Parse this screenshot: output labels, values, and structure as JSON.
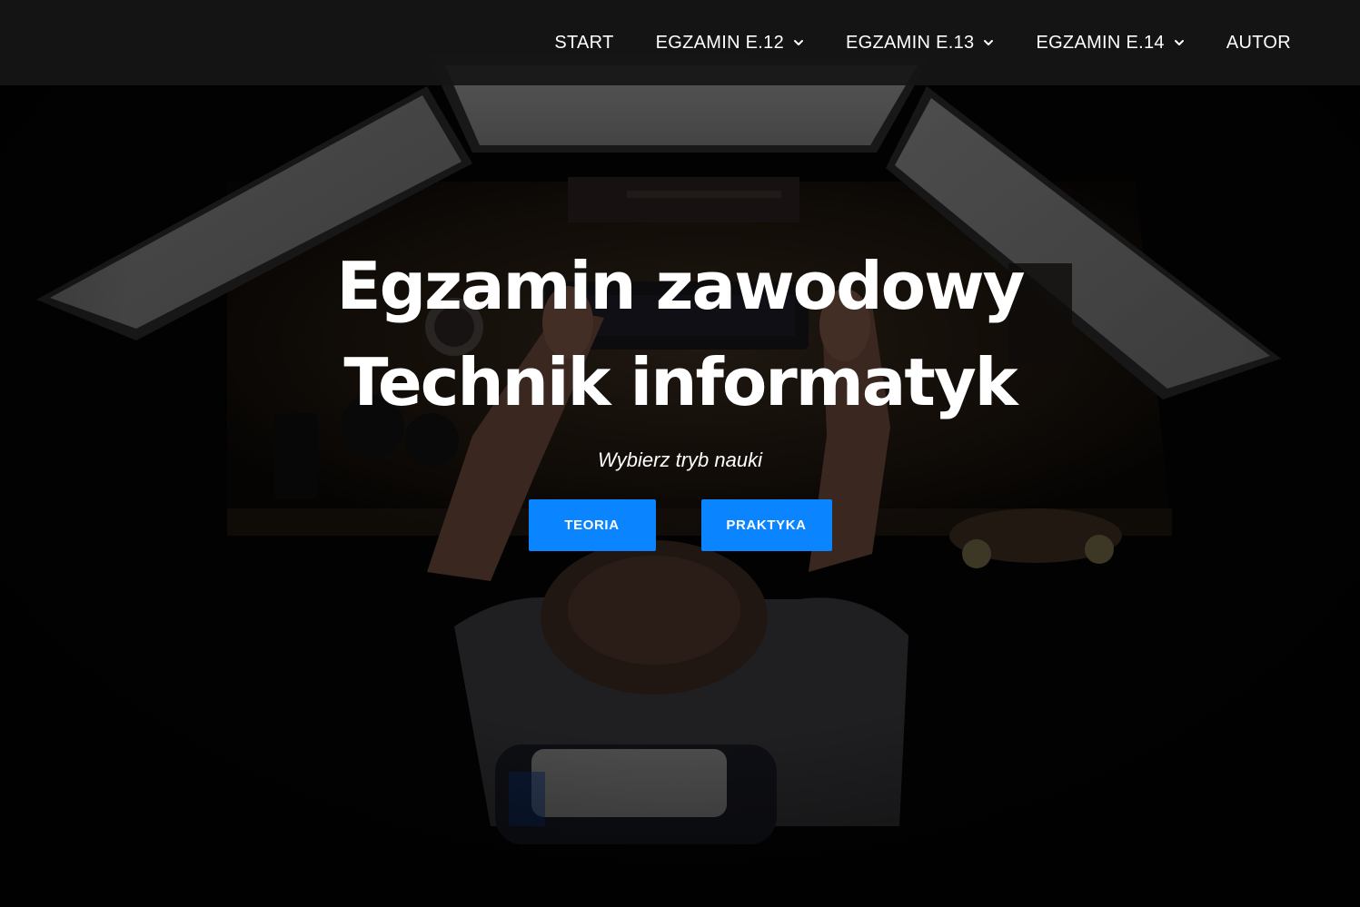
{
  "nav": {
    "items": [
      {
        "label": "START",
        "has_dropdown": false
      },
      {
        "label": "EGZAMIN E.12",
        "has_dropdown": true
      },
      {
        "label": "EGZAMIN E.13",
        "has_dropdown": true
      },
      {
        "label": "EGZAMIN E.14",
        "has_dropdown": true
      },
      {
        "label": "AUTOR",
        "has_dropdown": false
      }
    ],
    "dropdown_icon": "chevron-down-icon"
  },
  "hero": {
    "title_line1": "Egzamin zawodowy",
    "title_line2": "Technik informatyk",
    "subtitle": "Wybierz tryb nauki",
    "buttons": {
      "teoria": "TEORIA",
      "praktyka": "PRAKTYKA"
    }
  },
  "colors": {
    "accent": "#0a84ff",
    "navbar_bg": "#161616",
    "text": "#ffffff"
  }
}
